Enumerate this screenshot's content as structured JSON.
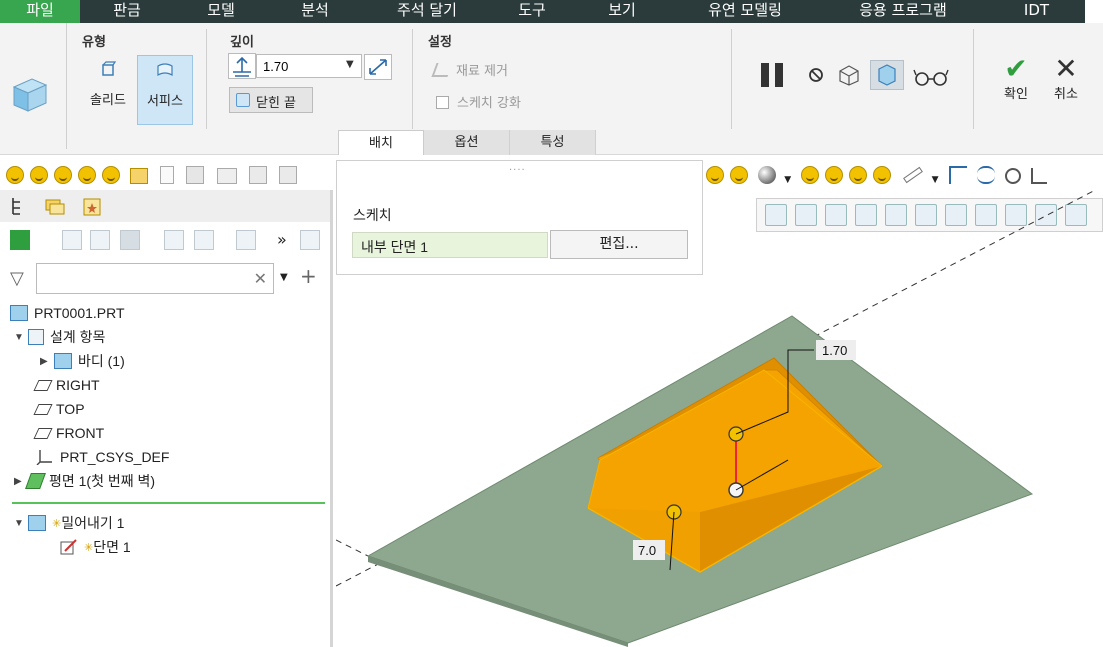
{
  "menu": {
    "items": [
      "파일",
      "판금",
      "모델",
      "분석",
      "주석 달기",
      "도구",
      "보기",
      "유연 모델링",
      "응용 프로그램",
      "IDT"
    ],
    "active_index": 0
  },
  "ribbon": {
    "type_group": {
      "title": "유형",
      "solid": "솔리드",
      "surface": "서피스"
    },
    "depth_group": {
      "title": "깊이",
      "value": "1.70",
      "closed_end": "닫힌 끝"
    },
    "settings_group": {
      "title": "설정",
      "remove_material": "재료 제거",
      "sketch_strengthen": "스케치 강화"
    },
    "confirm": "확인",
    "cancel": "취소",
    "tabs": [
      "배치",
      "옵션",
      "특성"
    ]
  },
  "dashboard": {
    "title": "스케치",
    "sketch_value": "내부 단면 1",
    "edit_button": "편집..."
  },
  "tree": {
    "nodes": [
      {
        "label": "PRT0001.PRT"
      },
      {
        "label": "설계 항목"
      },
      {
        "label": "바디 (1)"
      },
      {
        "label": "RIGHT"
      },
      {
        "label": "TOP"
      },
      {
        "label": "FRONT"
      },
      {
        "label": "PRT_CSYS_DEF"
      },
      {
        "label": "평면 1(첫 번째 벽)"
      },
      {
        "label": "밀어내기 1"
      },
      {
        "label": "단면 1"
      }
    ]
  },
  "graphics": {
    "dim_depth": "1.70",
    "dim_length": "7.0",
    "colors": {
      "plate": "#8ea88f",
      "extrude": "#f5a300",
      "extrude_side": "#e08f00"
    }
  }
}
